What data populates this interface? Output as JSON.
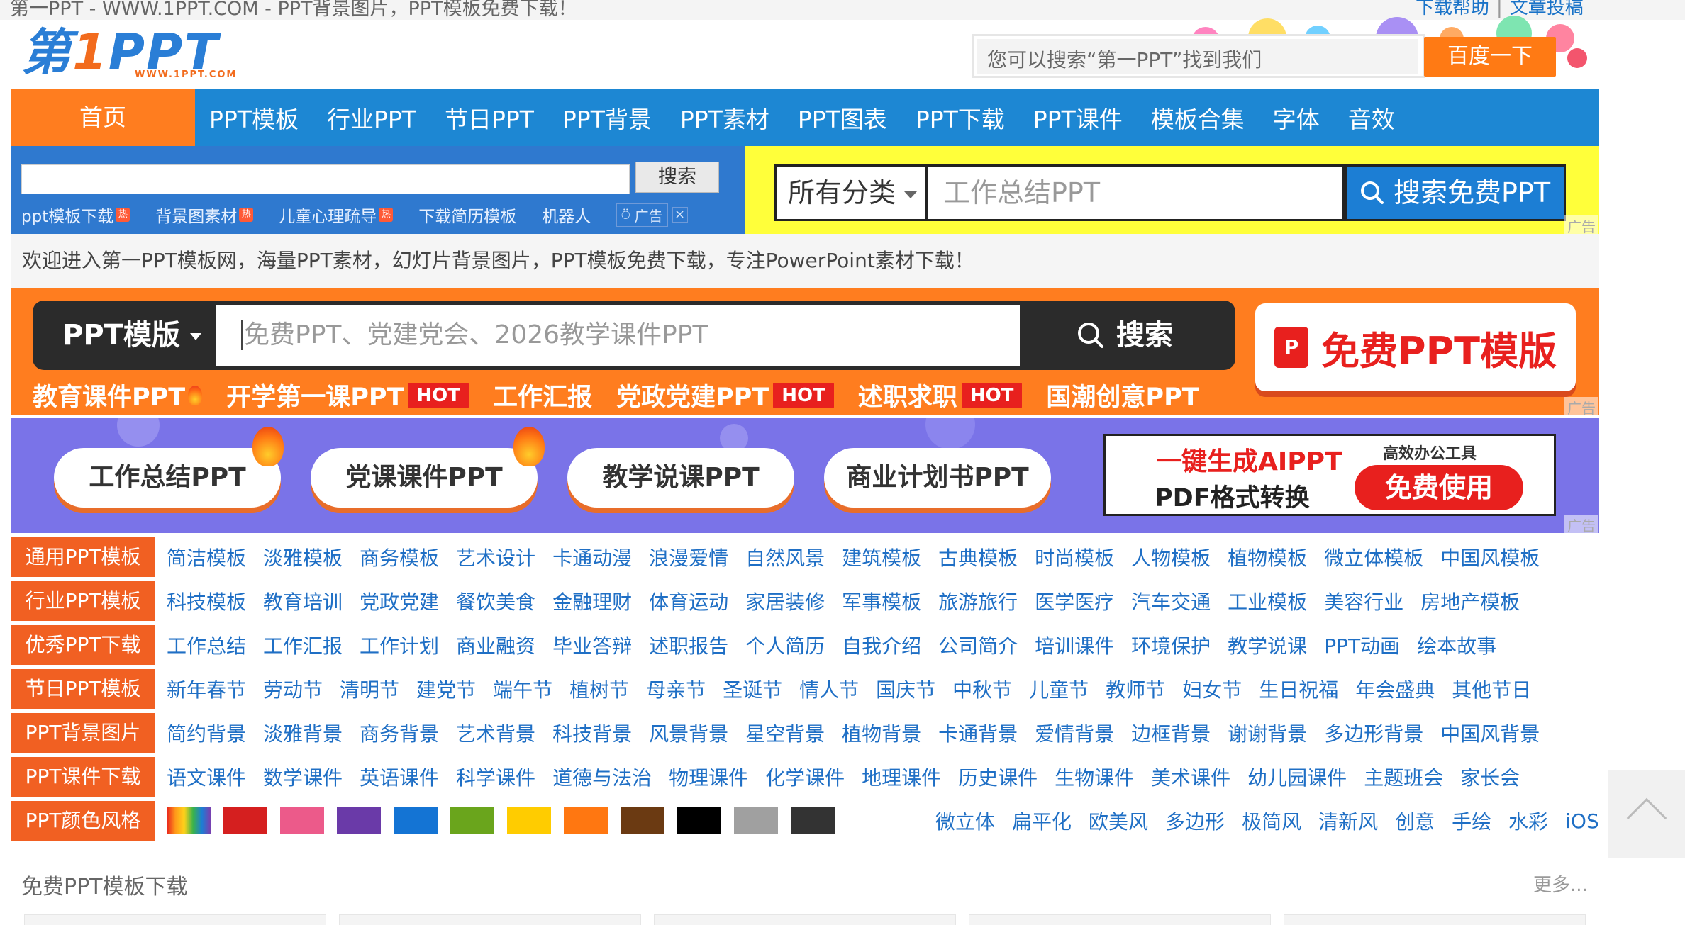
{
  "browser": {
    "page_title": "第一PPT - WWW.1PPT.COM - PPT背景图片，PPT模板免费下载！",
    "links": [
      "下载帮助",
      "文章投稿"
    ]
  },
  "logo": {
    "main_prefix": "第",
    "main_one": "1",
    "main_suffix": "PPT",
    "url": "WWW.1PPT.COM"
  },
  "baidu": {
    "placeholder": "您可以搜索“第一PPT”找到我们",
    "button": "百度一下"
  },
  "nav": {
    "home": "首页",
    "items": [
      "PPT模板",
      "行业PPT",
      "节日PPT",
      "PPT背景",
      "PPT素材",
      "PPT图表",
      "PPT下载",
      "PPT课件",
      "模板合集",
      "字体",
      "音效"
    ]
  },
  "site_search": {
    "button": "搜索",
    "tags": [
      "ppt模板下载",
      "背景图素材",
      "儿童心理疏导",
      "下载简历模板",
      "机器人"
    ],
    "hot_badge": "热",
    "ad_label": "广告",
    "ad_close": "×"
  },
  "free_search": {
    "category": "所有分类",
    "placeholder": "工作总结PPT",
    "button": "搜索免费PPT",
    "ad": "广告"
  },
  "welcome": "欢迎进入第一PPT模板网，海量PPT素材，幻灯片背景图片，PPT模板免费下载，专注PowerPoint素材下载！",
  "promo_orange": {
    "select": "PPT模版",
    "placeholder": "免费PPT、党建党会、2026教学课件PPT",
    "search": "搜索",
    "free_button": "免费PPT模版",
    "pdf_icon_glyph": "P",
    "tags": [
      {
        "label": "教育课件PPT",
        "flame": true,
        "hot": ""
      },
      {
        "label": "开学第一课PPT",
        "flame": false,
        "hot": "HOT"
      },
      {
        "label": "工作汇报",
        "flame": false,
        "hot": ""
      },
      {
        "label": "党政党建PPT",
        "flame": false,
        "hot": "HOT"
      },
      {
        "label": "述职求职",
        "flame": false,
        "hot": "HOT"
      },
      {
        "label": "国潮创意PPT",
        "flame": false,
        "hot": ""
      }
    ],
    "ad": "广告"
  },
  "promo_purple": {
    "pills": [
      "工作总结PPT",
      "党课课件PPT",
      "教学说课PPT",
      "商业计划书PPT"
    ],
    "ai_line1": "一键生成AIPPT",
    "ai_line2": "PDF格式转换",
    "ai_tag": "高效办公工具",
    "ai_button": "免费使用",
    "ad": "广告"
  },
  "categories": [
    {
      "label": "通用PPT模板",
      "links": [
        "简洁模板",
        "淡雅模板",
        "商务模板",
        "艺术设计",
        "卡通动漫",
        "浪漫爱情",
        "自然风景",
        "建筑模板",
        "古典模板",
        "时尚模板",
        "人物模板",
        "植物模板",
        "微立体模板",
        "中国风模板"
      ]
    },
    {
      "label": "行业PPT模板",
      "links": [
        "科技模板",
        "教育培训",
        "党政党建",
        "餐饮美食",
        "金融理财",
        "体育运动",
        "家居装修",
        "军事模板",
        "旅游旅行",
        "医学医疗",
        "汽车交通",
        "工业模板",
        "美容行业",
        "房地产模板"
      ]
    },
    {
      "label": "优秀PPT下载",
      "links": [
        "工作总结",
        "工作汇报",
        "工作计划",
        "商业融资",
        "毕业答辩",
        "述职报告",
        "个人简历",
        "自我介绍",
        "公司简介",
        "培训课件",
        "环境保护",
        "教学说课",
        "PPT动画",
        "绘本故事"
      ]
    },
    {
      "label": "节日PPT模板",
      "links": [
        "新年春节",
        "劳动节",
        "清明节",
        "建党节",
        "端午节",
        "植树节",
        "母亲节",
        "圣诞节",
        "情人节",
        "国庆节",
        "中秋节",
        "儿童节",
        "教师节",
        "妇女节",
        "生日祝福",
        "年会盛典",
        "其他节日"
      ]
    },
    {
      "label": "PPT背景图片",
      "links": [
        "简约背景",
        "淡雅背景",
        "商务背景",
        "艺术背景",
        "科技背景",
        "风景背景",
        "星空背景",
        "植物背景",
        "卡通背景",
        "爱情背景",
        "边框背景",
        "谢谢背景",
        "多边形背景",
        "中国风背景"
      ]
    },
    {
      "label": "PPT课件下载",
      "links": [
        "语文课件",
        "数学课件",
        "英语课件",
        "科学课件",
        "道德与法治",
        "物理课件",
        "化学课件",
        "地理课件",
        "历史课件",
        "生物课件",
        "美术课件",
        "幼儿园课件",
        "主题班会",
        "家长会"
      ]
    }
  ],
  "color_row": {
    "label": "PPT颜色风格",
    "swatches": [
      "rainbow",
      "#d51f1f",
      "#ec5a8a",
      "#6a3aa8",
      "#1474d4",
      "#6aa51c",
      "#ffcc00",
      "#ff7711",
      "#6b3a12",
      "#000000",
      "#a0a0a0",
      "#333333",
      "#ffffff"
    ],
    "styles": [
      "微立体",
      "扁平化",
      "欧美风",
      "多边形",
      "极简风",
      "清新风",
      "创意",
      "手绘",
      "水彩",
      "iOS"
    ]
  },
  "section": {
    "title": "免费PPT模板下载",
    "more": "更多..."
  }
}
